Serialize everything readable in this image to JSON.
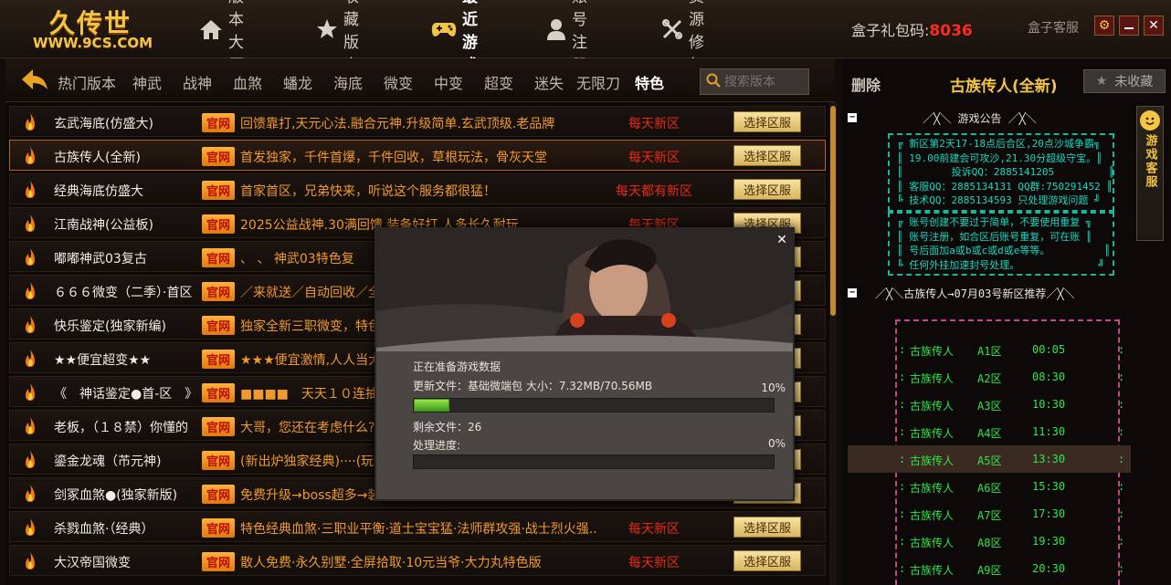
{
  "header": {
    "logo_title": "久传世",
    "logo_url": "WWW.9CS.COM",
    "nav": [
      {
        "label": "版本大厅",
        "icon": "home-icon"
      },
      {
        "label": "收藏版本",
        "icon": "star-icon"
      },
      {
        "label": "最近游戏",
        "icon": "gamepad-icon",
        "active": true
      },
      {
        "label": "账号注册",
        "icon": "user-icon"
      },
      {
        "label": "资源修复",
        "icon": "tools-icon"
      }
    ],
    "gift_label": "盒子礼包码:",
    "gift_code": "8036",
    "service_label": "盒子客服"
  },
  "categories": {
    "items": [
      "热门版本",
      "神武",
      "战神",
      "血煞",
      "蟠龙",
      "海底",
      "微变",
      "中变",
      "超变",
      "迷失",
      "无限刀",
      "特色"
    ],
    "active": "特色",
    "search_placeholder": "搜索版本"
  },
  "servers": [
    {
      "name": "玄武海底(仿盛大)",
      "tag": "官网",
      "desc": "回馈靠打,天元心法.融合元神.升级简单.玄武顶级.老品牌",
      "newzone": "每天新区",
      "button": "选择区服"
    },
    {
      "name": "古族传人(全新)",
      "tag": "官网",
      "desc": "首发独家，千件首爆，千件回收，草根玩法，骨灰天堂",
      "newzone": "每天新区",
      "button": "选择区服",
      "selected": true
    },
    {
      "name": "经典海底仿盛大",
      "tag": "官网",
      "desc": "首家首区，兄弟快来，听说这个服务都很猛！",
      "newzone": "每天都有新区",
      "button": "选择区服"
    },
    {
      "name": "江南战神(公益板)",
      "tag": "官网",
      "desc": "2025公益战神.30满回馈.装备好打.人多长久耐玩",
      "newzone": "每天新区",
      "button": "选择区服"
    },
    {
      "name": "嘟嘟神武03复古",
      "tag": "官网",
      "desc": "、 、    神武03特色复",
      "newzone": "",
      "button": "选择区服"
    },
    {
      "name": "６６６微变（二季）·首区",
      "tag": "官网",
      "desc": "／来就送／自动回收／全",
      "newzone": "",
      "button": "选择区服"
    },
    {
      "name": "快乐鉴定(独家新编)",
      "tag": "官网",
      "desc": "独家全新三职微变，特色",
      "newzone": "",
      "button": "选择区服"
    },
    {
      "name": "★★便宜超变★★",
      "tag": "官网",
      "desc": "★★★便宜激情,人人当大",
      "newzone": "",
      "button": "选择区服"
    },
    {
      "name": "《　神话鉴定●首-区　》",
      "tag": "官网",
      "desc": "■■■■　天天１０连抽",
      "newzone": "",
      "button": "选择区服"
    },
    {
      "name": "老板，（１８禁）你懂的",
      "tag": "官网",
      "desc": "大哥，您还在考虑什么?",
      "newzone": "",
      "button": "选择区服"
    },
    {
      "name": "鎏金龙魂（芇元神)",
      "tag": "官网",
      "desc": "(新出炉独家经典)····(玩法",
      "newzone": "",
      "button": "选择区服"
    },
    {
      "name": "剑冢血煞●(独家新版)",
      "tag": "官网",
      "desc": "免费升级→boss超多→装",
      "newzone": "",
      "button": "选择区服"
    },
    {
      "name": "杀戮血煞·（经典）",
      "tag": "官网",
      "desc": "特色经典血煞·三职业平衡·道士宝宝猛·法师群攻强·战士烈火强..",
      "newzone": "每天新区",
      "button": "选择区服"
    },
    {
      "name": "大汉帝国微变",
      "tag": "官网",
      "desc": "散人免费·永久别墅·全屏拾取·10元当爷·大力丸特色版",
      "newzone": "每天新区",
      "button": "选择区服"
    }
  ],
  "right": {
    "delete_label": "删除",
    "game_name": "古族传人(全新)",
    "unfav_label": "未收藏",
    "notice_head": "／╳＼ 游戏公告 ／╳＼",
    "notice_box1": "╔ 新区第2天17-18点后合区,20点沙城争霸╗\n║ 19.00前建会可攻沙,21.30分超级守宝。║\n║        投诉QQ：2885141205         ║\n║ 客服QQ：2885134131 QQ群:750291452 ║\n╚ 技术QQ：2885134593 只处理游戏问题 ╝",
    "notice_box2": "╔ 账号创建不要过于简单，不要使用重复 ╗\n║ 账号注册，如合区后账号重复，可在账 ║\n║ 号后面加a或b或c或d或e等等。         ║\n╚ 任何外挂加速封号处理。             ╝",
    "schedule_head": "／╳＼古族传人→07月03号新区推荐／╳＼",
    "schedule": [
      {
        "game": "古族传人",
        "zone": "A1区",
        "time": "00:05"
      },
      {
        "game": "古族传人",
        "zone": "A2区",
        "time": "08:30"
      },
      {
        "game": "古族传人",
        "zone": "A3区",
        "time": "10:30"
      },
      {
        "game": "古族传人",
        "zone": "A4区",
        "time": "11:30"
      },
      {
        "game": "古族传人",
        "zone": "A5区",
        "time": "13:30",
        "highlight": true
      },
      {
        "game": "古族传人",
        "zone": "A6区",
        "time": "15:30"
      },
      {
        "game": "古族传人",
        "zone": "A7区",
        "time": "17:30"
      },
      {
        "game": "古族传人",
        "zone": "A8区",
        "time": "19:30"
      },
      {
        "game": "古族传人",
        "zone": "A9区",
        "time": "20:30"
      }
    ],
    "kefu_label": "游戏客服"
  },
  "modal": {
    "status": "正在准备游戏数据",
    "update_file": "更新文件：基础微端包 大小：7.32MB/70.56MB",
    "update_percent": "10%",
    "update_progress": 0.1,
    "remaining": "剩余文件：26",
    "process_label": "处理进度:",
    "process_percent": "0%",
    "process_progress": 0.0
  },
  "colors": {
    "accent": "#f4c542",
    "tag_bg": "#e07a10",
    "new_zone": "#e82a18",
    "desc": "#f09a2e",
    "notice": "#17d8c0",
    "schedule": "#2ee848"
  }
}
